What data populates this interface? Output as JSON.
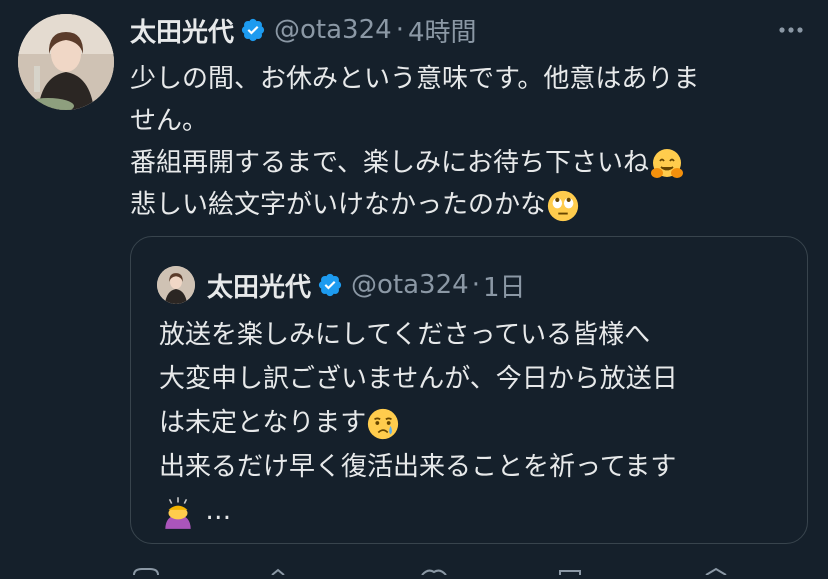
{
  "tweet": {
    "author_name": "太田光代",
    "handle": "@ota324",
    "separator": "·",
    "time": "4時間",
    "lines": [
      "少しの間、お休みという意味です。他意はありま",
      "せん。",
      "番組再開するまで、楽しみにお待ち下さいね",
      "悲しい絵文字がいけなかったのかな"
    ],
    "emoji_icons": [
      "hugging-face-emoji",
      "rolling-eyes-emoji"
    ]
  },
  "quoted_tweet": {
    "author_name": "太田光代",
    "handle": "@ota324",
    "separator": "·",
    "time": "1日",
    "lines": [
      "放送を楽しみにしてくださっている皆様へ",
      "大変申し訳ございませんが、今日から放送日",
      "は未定となります",
      "出来るだけ早く復活出来ることを祈ってます",
      "…"
    ],
    "emoji_icons": [
      "crying-face-emoji",
      "person-bowing-emoji"
    ]
  },
  "colors": {
    "background": "#15202b",
    "text": "#e7e9ea",
    "secondary_text": "#8b98a5",
    "verified_badge": "#1d9bf0",
    "border": "#38444d"
  }
}
